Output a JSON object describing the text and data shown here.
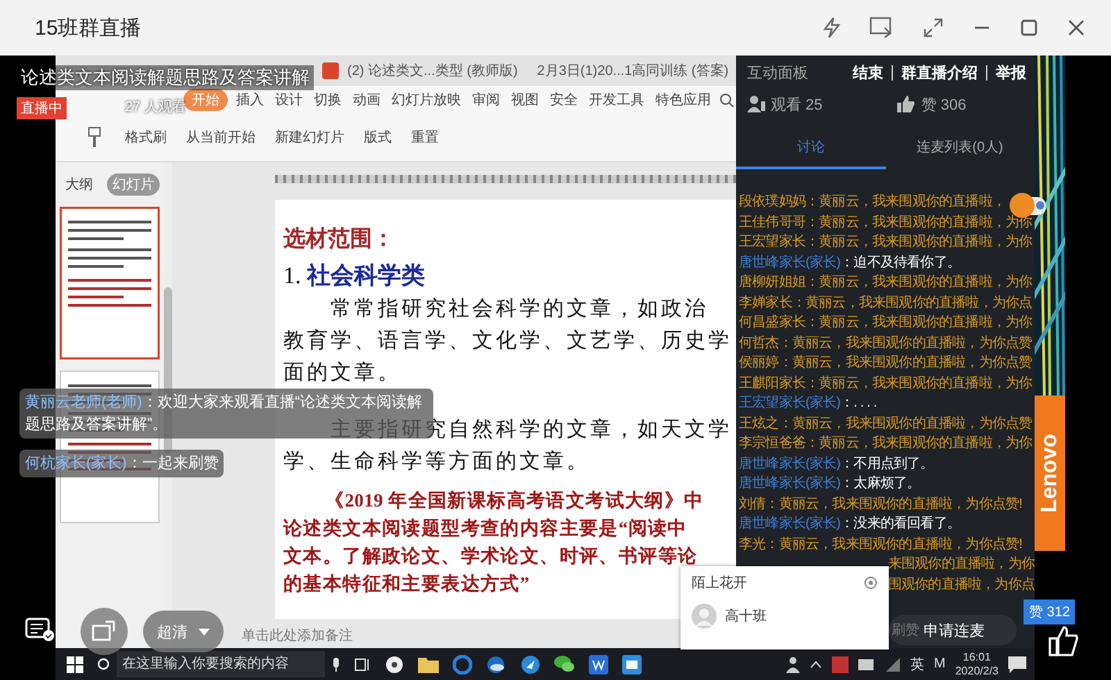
{
  "window": {
    "title": "15班群直播"
  },
  "stream": {
    "title": "论述类文本阅读解题思路及答案讲解",
    "status": "直播中",
    "viewers": "27 人观看",
    "quality": "超清"
  },
  "screen_share": {
    "doc_tabs": [
      {
        "label": "(2) 论述类文...类型 (教师版)",
        "selected": false
      },
      {
        "label": "2月3日(1)20...1高同训练 (答案)",
        "selected": false
      }
    ],
    "menu": [
      {
        "label": "开始",
        "selected": true
      },
      {
        "label": "插入",
        "selected": false
      },
      {
        "label": "设计",
        "selected": false
      },
      {
        "label": "切换",
        "selected": false
      },
      {
        "label": "动画",
        "selected": false
      },
      {
        "label": "幻灯片放映",
        "selected": false
      },
      {
        "label": "审阅",
        "selected": false
      },
      {
        "label": "视图",
        "selected": false
      },
      {
        "label": "安全",
        "selected": false
      },
      {
        "label": "开发工具",
        "selected": false
      },
      {
        "label": "特色应用",
        "selected": false
      }
    ],
    "ribbon": [
      "格式刷",
      "从当前开始",
      "新建幻灯片",
      "版式",
      "重置"
    ],
    "outline_tabs": [
      {
        "label": "大纲",
        "selected": false
      },
      {
        "label": "幻灯片",
        "selected": true
      }
    ],
    "thumbnails": [
      {
        "selected": true
      },
      {
        "selected": false
      }
    ],
    "slide": [
      {
        "kind": "heading",
        "text": "选材范围："
      },
      {
        "kind": "category",
        "number": "1.",
        "text": "社会科学类"
      },
      {
        "kind": "para",
        "text": "常常指研究社会科学的文章，如政治"
      },
      {
        "kind": "line",
        "text": "教育学、语言学、文化学、文艺学、历史学"
      },
      {
        "kind": "line",
        "text": "面的文章。"
      },
      {
        "kind": "gap"
      },
      {
        "kind": "para",
        "text": "主要指研究自然科学的文章，如天文学"
      },
      {
        "kind": "line",
        "text": "学、生命科学等方面的文章。"
      },
      {
        "kind": "quote_start",
        "text": "《2019 年全国新课标高考语文考试大纲》中"
      },
      {
        "kind": "quote",
        "text": "论述类文本阅读题型考查的内容主要是“阅读中"
      },
      {
        "kind": "quote",
        "text": "文本。了解政论文、学术论文、时评、书评等论"
      },
      {
        "kind": "quote",
        "text": "的基本特征和主要表达方式”"
      }
    ],
    "notes_placeholder": "单击此处添加备注"
  },
  "overlay_chat": [
    {
      "name": "黄丽云老师(老师)",
      "text": "：欢迎大家来观看直播“论述类文本阅读解题思路及答案讲解”。"
    },
    {
      "name": "何杭家长(家长)",
      "text": "：一起来刷赞"
    }
  ],
  "taskbar": {
    "search_placeholder": "在这里输入你要搜索的内容",
    "tray": [
      "英",
      "M"
    ],
    "time": "16:01",
    "date": "2020/2/3"
  },
  "panel": {
    "title": "互动面板",
    "links": [
      "结束",
      "群直播介绍",
      "举报"
    ],
    "watching": "观看 25",
    "likes": "赞 306",
    "tabs": [
      {
        "label": "讨论",
        "selected": true
      },
      {
        "label": "连麦列表(0人)",
        "selected": false
      }
    ],
    "messages": [
      {
        "kind": "cheer",
        "name": "段依璞妈妈",
        "text": "：黄丽云，我来围观你的直播啦，"
      },
      {
        "kind": "cheer",
        "name": "王佳伟哥哥",
        "text": "：黄丽云，我来围观你的直播啦，为你"
      },
      {
        "kind": "cheer",
        "name": "王宏望家长",
        "text": "：黄丽云，我来围观你的直播啦，为你"
      },
      {
        "kind": "comment",
        "name": "唐世峰家长(家长)",
        "text": "：迫不及待看你了。"
      },
      {
        "kind": "cheer",
        "name": "唐柳妍姐姐",
        "text": "：黄丽云，我来围观你的直播啦，为你"
      },
      {
        "kind": "cheer",
        "name": "李婵家长",
        "text": "：黄丽云，我来围观你的直播啦，为你点"
      },
      {
        "kind": "cheer",
        "name": "何昌盛家长",
        "text": "：黄丽云，我来围观你的直播啦，为你"
      },
      {
        "kind": "cheer",
        "name": "何哲杰",
        "text": "：黄丽云，我来围观你的直播啦，为你点赞"
      },
      {
        "kind": "cheer",
        "name": "侯丽婷",
        "text": "：黄丽云，我来围观你的直播啦，为你点赞"
      },
      {
        "kind": "cheer",
        "name": "王麒阳家长",
        "text": "：黄丽云，我来围观你的直播啦，为你"
      },
      {
        "kind": "comment",
        "name": "王宏望家长(家长)",
        "text": "：. . . ."
      },
      {
        "kind": "cheer",
        "name": "王炫之",
        "text": "：黄丽云，我来围观你的直播啦，为你点赞"
      },
      {
        "kind": "cheer",
        "name": "李宗恒爸爸",
        "text": "：黄丽云，我来围观你的直播啦，为你"
      },
      {
        "kind": "comment",
        "name": "唐世峰家长(家长)",
        "text": "：不用点到了。"
      },
      {
        "kind": "comment",
        "name": "唐世峰家长(家长)",
        "text": "：太麻烦了。"
      },
      {
        "kind": "cheer",
        "name": "刘倩",
        "text": "：黄丽云，我来围观你的直播啦，为你点赞!"
      },
      {
        "kind": "comment",
        "name": "唐世峰家长(家长)",
        "text": "：没来的看回看了。"
      },
      {
        "kind": "cheer",
        "name": "李光",
        "text": "：黄丽云，我来围观你的直播啦，为你点赞!"
      },
      {
        "kind": "partial",
        "text": "来围观你的直播啦，为你"
      },
      {
        "kind": "partial",
        "text": "围观你的直播啦，为你点"
      }
    ],
    "like_hint": "刷赞",
    "mic_button": "申请连麦",
    "like_count": "赞 312"
  },
  "popup": {
    "title": "陌上花开",
    "name": "高十班"
  },
  "wallpaper": {
    "brand": "Lenovo"
  }
}
